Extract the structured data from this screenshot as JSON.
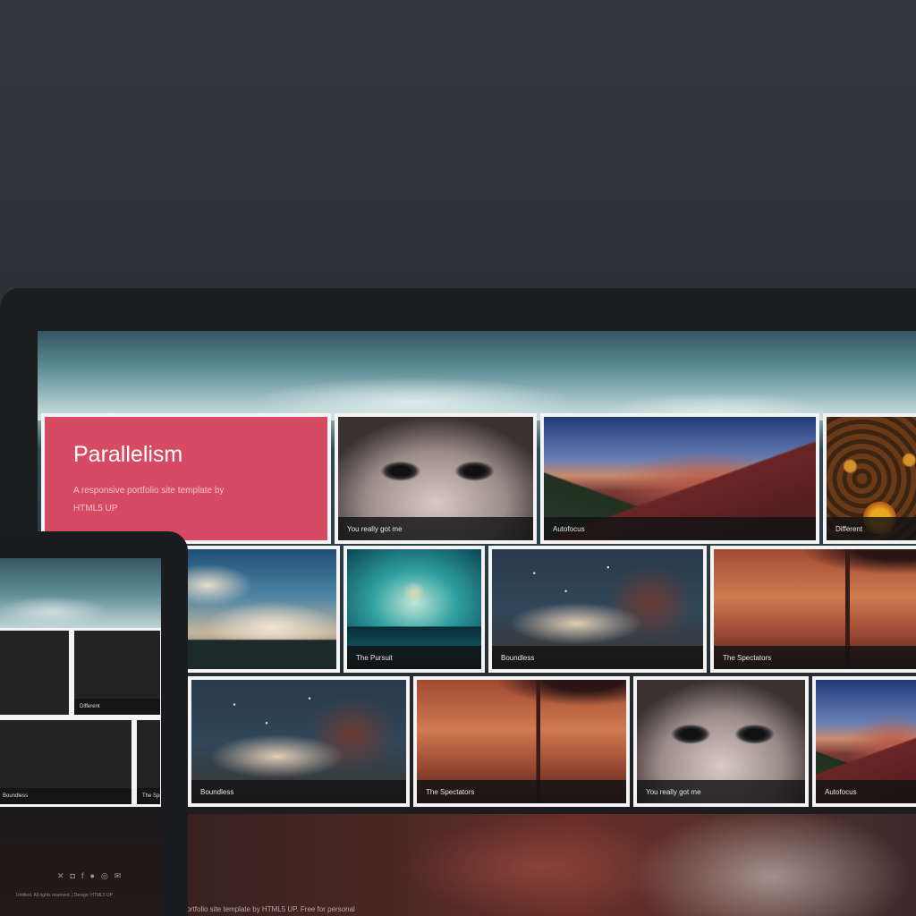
{
  "intro": {
    "title": "Parallelism",
    "subtitle": "A responsive portfolio site template by HTML5 UP"
  },
  "desktop_tiles": [
    {
      "caption": "You really got me",
      "image": "eyes-portrait"
    },
    {
      "caption": "Autofocus",
      "image": "mountain-landscape"
    },
    {
      "caption": "Different",
      "image": "sunflowers"
    },
    {
      "caption": "",
      "image": "windmills"
    },
    {
      "caption": "The Pursuit",
      "image": "lone-tree"
    },
    {
      "caption": "Boundless",
      "image": "woman-guitar"
    },
    {
      "caption": "The Spectators",
      "image": "birds-on-wire"
    },
    {
      "caption": "Boundless",
      "image": "woman-guitar"
    },
    {
      "caption": "The Spectators",
      "image": "birds-on-wire"
    },
    {
      "caption": "You really got me",
      "image": "eyes-portrait"
    },
    {
      "caption": "Autofocus",
      "image": "mountain-landscape"
    }
  ],
  "desktop_footer": "portfolio site template by HTML5 UP. Free for personal",
  "tablet": {
    "tiles": [
      {
        "caption": "",
        "image": "mountain-landscape"
      },
      {
        "caption": "Different",
        "image": "sunflowers"
      },
      {
        "caption": "Boundless",
        "image": "woman-guitar"
      },
      {
        "caption": "The Spe",
        "image": "birds-on-wire"
      }
    ],
    "social_icons": [
      "twitter-icon",
      "instagram-icon",
      "facebook-icon",
      "github-icon",
      "dribbble-icon",
      "email-icon"
    ],
    "social_glyphs": [
      "✕",
      "◘",
      "f",
      "●",
      "◎",
      "✉"
    ],
    "footer": "Untitled. All rights reserved. | Design: HTML5 UP"
  }
}
